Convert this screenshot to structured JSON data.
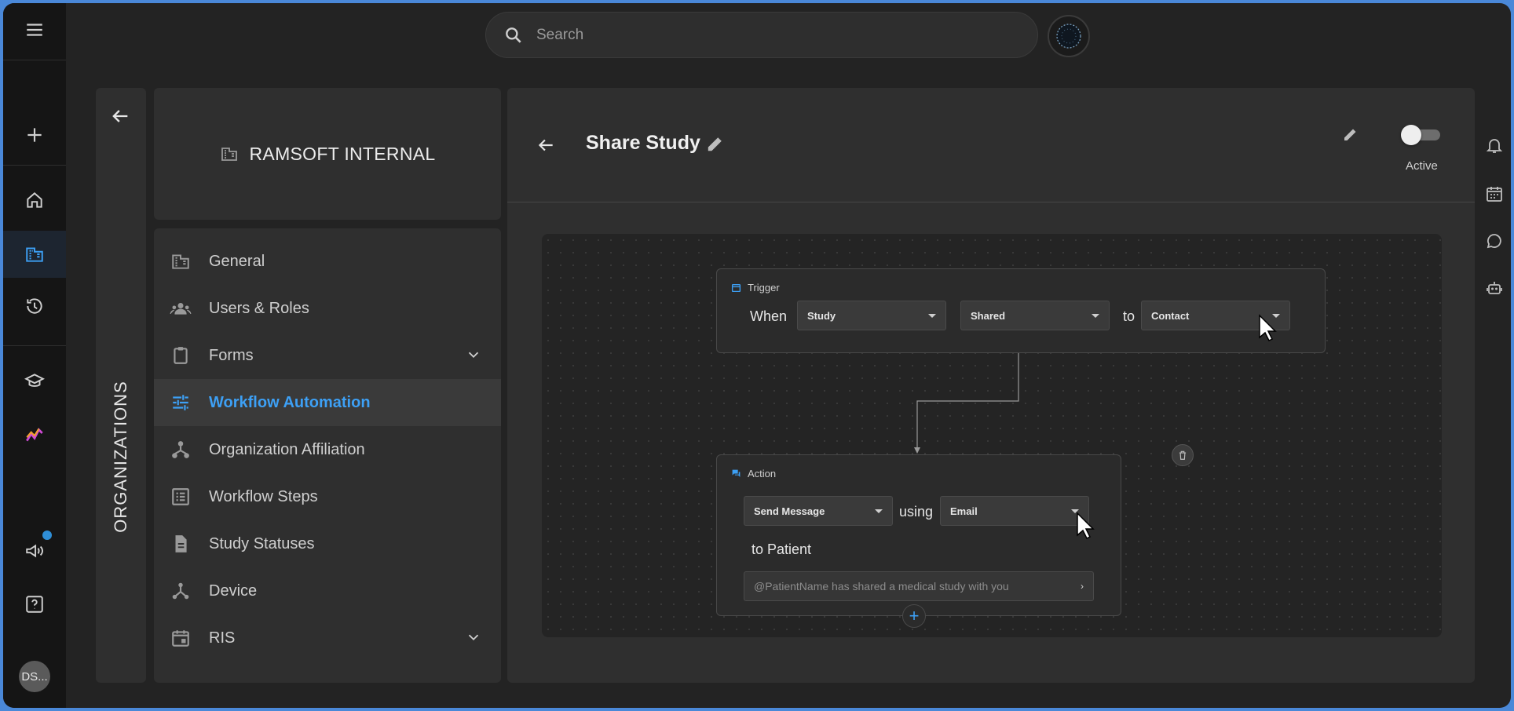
{
  "search": {
    "placeholder": "Search"
  },
  "rail": {
    "items": [
      "menu-icon",
      "plus-icon",
      "home-icon",
      "organization-icon",
      "history-icon",
      "school-icon",
      "analytics-icon",
      "megaphone-icon",
      "help-icon"
    ],
    "avatar": "DS..."
  },
  "organizations_label": "ORGANIZATIONS",
  "org": {
    "name": "RAMSOFT INTERNAL"
  },
  "menu": {
    "items": [
      {
        "label": "General"
      },
      {
        "label": "Users & Roles"
      },
      {
        "label": "Forms"
      },
      {
        "label": "Workflow Automation"
      },
      {
        "label": "Organization Affiliation"
      },
      {
        "label": "Workflow Steps"
      },
      {
        "label": "Study Statuses"
      },
      {
        "label": "Device"
      },
      {
        "label": "RIS"
      }
    ]
  },
  "main": {
    "title": "Share Study",
    "toggle_label": "Active",
    "toggle_on": false
  },
  "trigger": {
    "header": "Trigger",
    "when": "When",
    "subject": "Study",
    "event": "Shared",
    "to": "to",
    "target": "Contact"
  },
  "action": {
    "header": "Action",
    "type": "Send Message",
    "using": "using",
    "channel": "Email",
    "to_patient": "to Patient",
    "message_placeholder": "@PatientName has shared a medical study with you"
  },
  "colors": {
    "accent": "#3da0f5",
    "background": "#232323",
    "panel": "#2f2f2f"
  }
}
